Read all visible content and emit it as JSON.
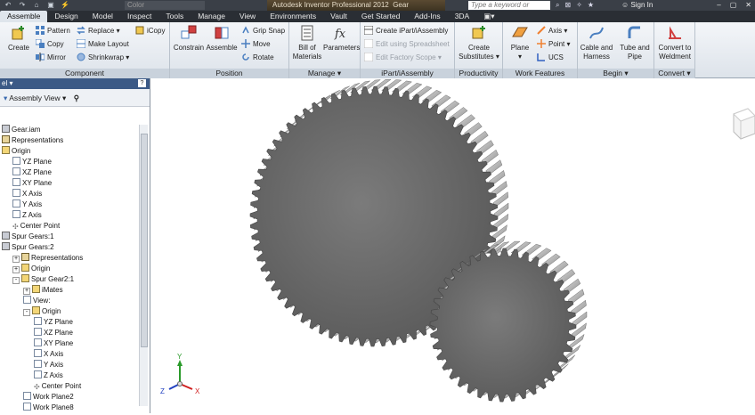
{
  "title_bar": {
    "color_box": "Color",
    "app_title": "Autodesk Inventor Professional 2012",
    "doc_fragment": "Gear",
    "search_placeholder": "Type a keyword or phrase",
    "sign_in": "Sign In"
  },
  "menu_tabs": [
    "Assemble",
    "Design",
    "Model",
    "Inspect",
    "Tools",
    "Manage",
    "View",
    "Environments",
    "Vault",
    "Get Started",
    "Add-Ins",
    "3DA"
  ],
  "ribbon": {
    "component": {
      "label": "Component",
      "create": "Create",
      "pattern": "Pattern",
      "copy": "Copy",
      "mirror": "Mirror",
      "replace": "Replace",
      "make_layout": "Make Layout",
      "shrinkwrap": "Shrinkwrap",
      "icopy": "iCopy"
    },
    "position": {
      "label": "Position",
      "constrain": "Constrain",
      "assemble": "Assemble",
      "grip_snap": "Grip Snap",
      "move": "Move",
      "rotate": "Rotate"
    },
    "manage": {
      "label": "Manage",
      "bom_line1": "Bill of",
      "bom_line2": "Materials",
      "parameters": "Parameters"
    },
    "ipart": {
      "label": "iPart/iAssembly",
      "create": "Create iPart/iAssembly",
      "edit_spreadsheet": "Edit using Spreadsheet",
      "edit_factory": "Edit Factory Scope"
    },
    "productivity": {
      "label": "Productivity",
      "line1": "Create",
      "line2": "Substitutes"
    },
    "work_features": {
      "label": "Work Features",
      "plane": "Plane",
      "axis": "Axis",
      "point": "Point",
      "ucs": "UCS"
    },
    "begin": {
      "label": "Begin",
      "cable_line1": "Cable and",
      "cable_line2": "Harness",
      "tube_line1": "Tube and",
      "tube_line2": "Pipe"
    },
    "convert": {
      "label": "Convert",
      "line1": "Convert to",
      "line2": "Weldment"
    }
  },
  "browser": {
    "header": "el",
    "view_selector": "Assembly View",
    "tree": [
      {
        "level": 0,
        "text": "Gear.iam",
        "icon": "part",
        "exp": ""
      },
      {
        "level": 0,
        "text": "Representations",
        "icon": "rep",
        "exp": ""
      },
      {
        "level": 0,
        "text": "Origin",
        "icon": "folder",
        "exp": ""
      },
      {
        "level": 1,
        "text": "YZ Plane",
        "icon": "plane",
        "exp": ""
      },
      {
        "level": 1,
        "text": "XZ Plane",
        "icon": "plane",
        "exp": ""
      },
      {
        "level": 1,
        "text": "XY Plane",
        "icon": "plane",
        "exp": ""
      },
      {
        "level": 1,
        "text": "X Axis",
        "icon": "axis",
        "exp": ""
      },
      {
        "level": 1,
        "text": "Y Axis",
        "icon": "axis",
        "exp": ""
      },
      {
        "level": 1,
        "text": "Z Axis",
        "icon": "axis",
        "exp": ""
      },
      {
        "level": 1,
        "text": "Center Point",
        "icon": "pt",
        "exp": ""
      },
      {
        "level": 0,
        "text": "Spur Gears:1",
        "icon": "part",
        "exp": ""
      },
      {
        "level": 0,
        "text": "Spur Gears:2",
        "icon": "part",
        "exp": ""
      },
      {
        "level": 1,
        "text": "Representations",
        "icon": "rep",
        "exp": "+"
      },
      {
        "level": 1,
        "text": "Origin",
        "icon": "folder",
        "exp": "+"
      },
      {
        "level": 1,
        "text": "Spur Gear2:1",
        "icon": "folder",
        "exp": "-"
      },
      {
        "level": 2,
        "text": "iMates",
        "icon": "folder",
        "exp": "+"
      },
      {
        "level": 2,
        "text": "View:",
        "icon": "plane",
        "exp": ""
      },
      {
        "level": 2,
        "text": "Origin",
        "icon": "folder",
        "exp": "-"
      },
      {
        "level": 3,
        "text": "YZ Plane",
        "icon": "plane",
        "exp": ""
      },
      {
        "level": 3,
        "text": "XZ Plane",
        "icon": "plane",
        "exp": ""
      },
      {
        "level": 3,
        "text": "XY Plane",
        "icon": "plane",
        "exp": ""
      },
      {
        "level": 3,
        "text": "X Axis",
        "icon": "axis",
        "exp": ""
      },
      {
        "level": 3,
        "text": "Y Axis",
        "icon": "axis",
        "exp": ""
      },
      {
        "level": 3,
        "text": "Z Axis",
        "icon": "axis",
        "exp": ""
      },
      {
        "level": 3,
        "text": "Center Point",
        "icon": "pt",
        "exp": ""
      },
      {
        "level": 2,
        "text": "Work Plane2",
        "icon": "plane",
        "exp": ""
      },
      {
        "level": 2,
        "text": "Work Plane8",
        "icon": "plane",
        "exp": ""
      }
    ]
  },
  "triad": {
    "y": "Y",
    "z": "Z",
    "x": "X"
  },
  "colors": {
    "menubar": "#2a2e34",
    "active_tab": "#dfe5ec",
    "browser_header": "#3c5a86",
    "gear": "#6d6d6d"
  }
}
